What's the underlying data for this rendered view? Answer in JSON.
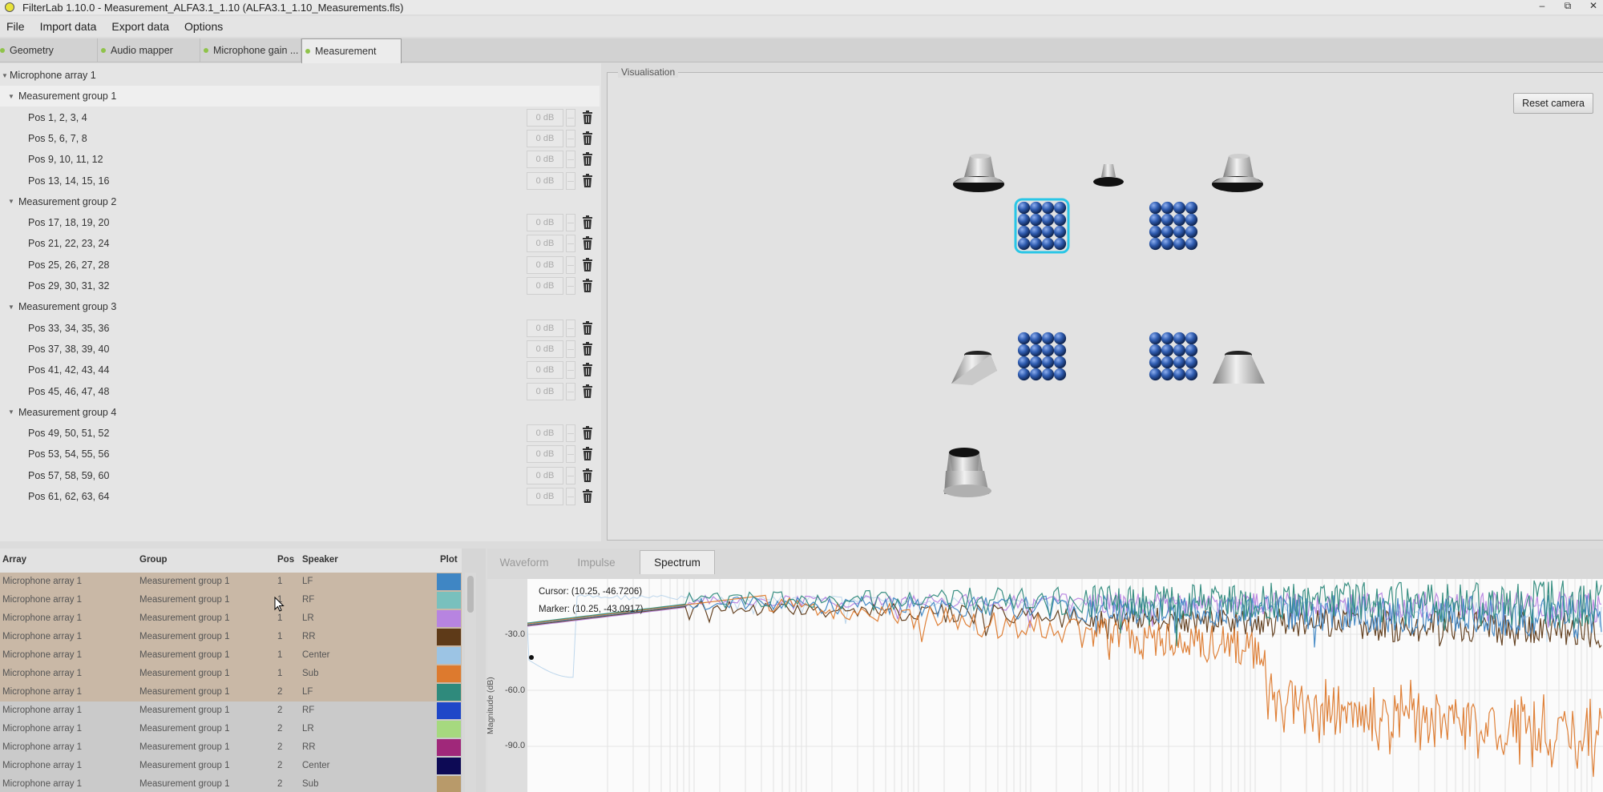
{
  "window": {
    "title": "FilterLab 1.10.0 - Measurement_ALFA3.1_1.10 (ALFA3.1_1.10_Measurements.fls)",
    "controls": [
      "–",
      "⧉",
      "✕"
    ]
  },
  "menu": [
    "File",
    "Import data",
    "Export data",
    "Options"
  ],
  "tabs": [
    {
      "label": "Geometry"
    },
    {
      "label": "Audio mapper"
    },
    {
      "label": "Microphone gain ..."
    },
    {
      "label": "Measurement"
    }
  ],
  "active_tab": "Measurement",
  "tree": {
    "root": "Microphone array 1",
    "groups": [
      {
        "label": "Measurement group 1",
        "positions": [
          "Pos 1, 2, 3, 4",
          "Pos 5, 6, 7, 8",
          "Pos 9, 10, 11, 12",
          "Pos 13, 14, 15, 16"
        ]
      },
      {
        "label": "Measurement group 2",
        "positions": [
          "Pos 17, 18, 19, 20",
          "Pos 21, 22, 23, 24",
          "Pos 25, 26, 27, 28",
          "Pos 29, 30, 31, 32"
        ]
      },
      {
        "label": "Measurement group 3",
        "positions": [
          "Pos 33, 34, 35, 36",
          "Pos 37, 38, 39, 40",
          "Pos 41, 42, 43, 44",
          "Pos 45, 46, 47, 48"
        ]
      },
      {
        "label": "Measurement group 4",
        "positions": [
          "Pos 49, 50, 51, 52",
          "Pos 53, 54, 55, 56",
          "Pos 57, 58, 59, 60",
          "Pos 61, 62, 63, 64"
        ]
      }
    ],
    "gain_value": "0 dB"
  },
  "visualisation": {
    "legend": "Visualisation",
    "reset_button": "Reset camera"
  },
  "table": {
    "headers": {
      "array": "Array",
      "group": "Group",
      "pos": "Pos",
      "speaker": "Speaker",
      "plot": "Plot"
    },
    "rows": [
      {
        "array": "Microphone array 1",
        "group": "Measurement group 1",
        "pos": "1",
        "speaker": "LF",
        "color": "#3f86c4",
        "selected": true
      },
      {
        "array": "Microphone array 1",
        "group": "Measurement group 1",
        "pos": "1",
        "speaker": "RF",
        "color": "#79c0bd",
        "selected": true
      },
      {
        "array": "Microphone array 1",
        "group": "Measurement group 1",
        "pos": "1",
        "speaker": "LR",
        "color": "#b784e0",
        "selected": true
      },
      {
        "array": "Microphone array 1",
        "group": "Measurement group 1",
        "pos": "1",
        "speaker": "RR",
        "color": "#5e3a18",
        "selected": true
      },
      {
        "array": "Microphone array 1",
        "group": "Measurement group 1",
        "pos": "1",
        "speaker": "Center",
        "color": "#9cc4e4",
        "selected": true
      },
      {
        "array": "Microphone array 1",
        "group": "Measurement group 1",
        "pos": "1",
        "speaker": "Sub",
        "color": "#dd7a2e",
        "selected": true
      },
      {
        "array": "Microphone array 1",
        "group": "Measurement group 1",
        "pos": "2",
        "speaker": "LF",
        "color": "#2f8a7c",
        "selected": true
      },
      {
        "array": "Microphone array 1",
        "group": "Measurement group 1",
        "pos": "2",
        "speaker": "RF",
        "color": "#1f47c8",
        "selected": false
      },
      {
        "array": "Microphone array 1",
        "group": "Measurement group 1",
        "pos": "2",
        "speaker": "LR",
        "color": "#a6d97f",
        "selected": false
      },
      {
        "array": "Microphone array 1",
        "group": "Measurement group 1",
        "pos": "2",
        "speaker": "RR",
        "color": "#a0287a",
        "selected": false
      },
      {
        "array": "Microphone array 1",
        "group": "Measurement group 1",
        "pos": "2",
        "speaker": "Center",
        "color": "#0d0a55",
        "selected": false
      },
      {
        "array": "Microphone array 1",
        "group": "Measurement group 1",
        "pos": "2",
        "speaker": "Sub",
        "color": "#b89a6a",
        "selected": false
      }
    ]
  },
  "plot": {
    "tabs": [
      "Waveform",
      "Impulse",
      "Spectrum"
    ],
    "active_tab": "Spectrum",
    "cursor_readout": "Cursor: (10.25, -46.7206)",
    "marker_readout": "Marker: (10.25, -43.0917)",
    "ylabel": "Magnitude (dB)",
    "yticks": [
      "-30.0",
      "-60.0",
      "-90.0"
    ]
  },
  "icons": {
    "trash": "trash-icon",
    "caret": "tree-caret-icon",
    "cursor": "mouse-pointer-icon",
    "speaker": "speaker-icon",
    "mic_grid": "microphone-grid-icon"
  },
  "colors": {
    "selected_row": "#c9b8a6",
    "accent_dot": "#8fc34a",
    "mic_blue": "#2f5cb0",
    "mic_highlight": "#29c6e6"
  }
}
